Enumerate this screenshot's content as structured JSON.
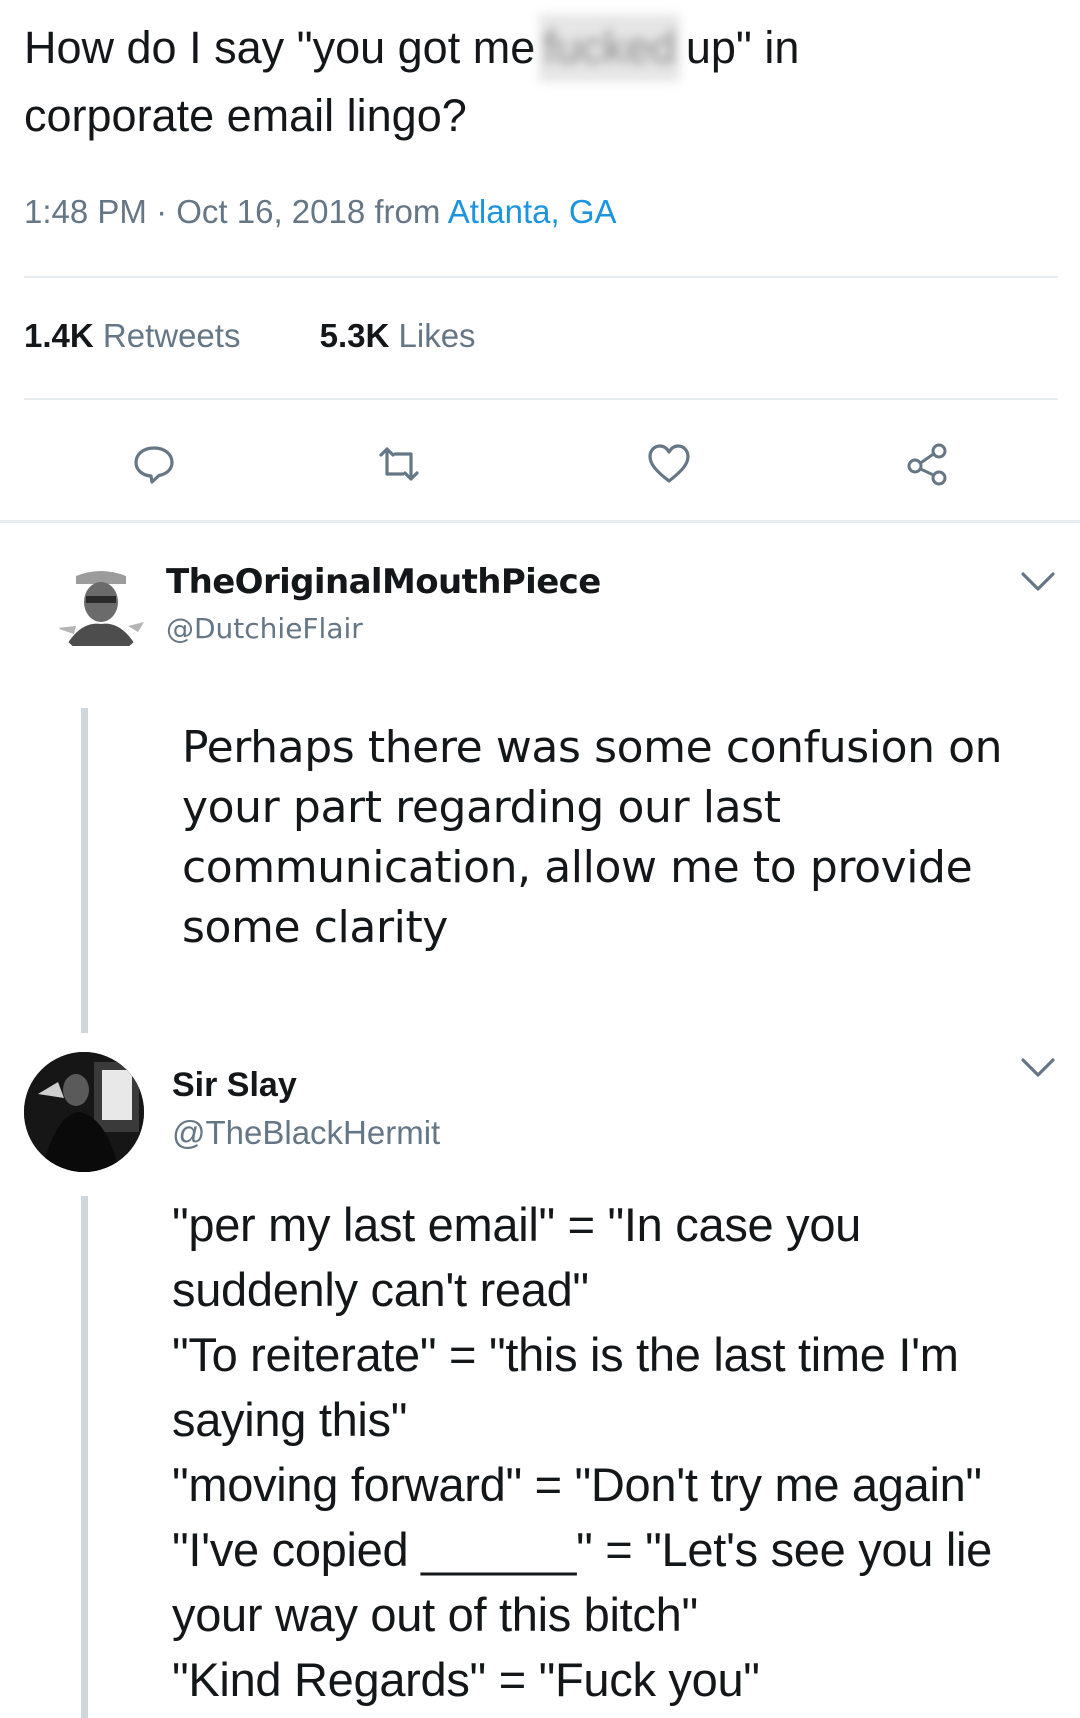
{
  "main_tweet": {
    "text_part1": "How do I say \"you got me",
    "censored_word": "fucked",
    "text_part2": "up\" in",
    "text_line2": "corporate email lingo?",
    "time": "1:48 PM",
    "separator": "·",
    "date": "Oct 16, 2018",
    "from_label": "from",
    "location": "Atlanta, GA",
    "retweets_count": "1.4K",
    "retweets_label": "Retweets",
    "likes_count": "5.3K",
    "likes_label": "Likes"
  },
  "actions": {
    "reply_icon": "speech-bubble-icon",
    "retweet_icon": "retweet-icon",
    "like_icon": "heart-icon",
    "share_icon": "share-icon"
  },
  "replies": [
    {
      "display_name": "TheOriginalMouthPiece",
      "handle": "@DutchieFlair",
      "text_lines": [
        "Perhaps there was some confusion on",
        "your part regarding our last",
        "communication, allow me to provide",
        "some clarity"
      ]
    },
    {
      "display_name": "Sir Slay",
      "handle": "@TheBlackHermit",
      "text_lines": [
        "\"per my last email\" = \"In case you",
        "suddenly can't read\"",
        "\"To reiterate\" = \"this is the last time I'm",
        "saying this\"",
        "\"moving forward\" = \"Don't try me again\"",
        "\"I've copied ______\" = \"Let's see you lie",
        "your way out of this bitch\"",
        "\"Kind Regards\" = \"Fuck you\""
      ]
    }
  ],
  "colors": {
    "text": "#14171a",
    "secondary": "#657786",
    "link": "#1b95e0",
    "divider": "#e6ecf0",
    "thread_line": "#cfd6dc"
  }
}
